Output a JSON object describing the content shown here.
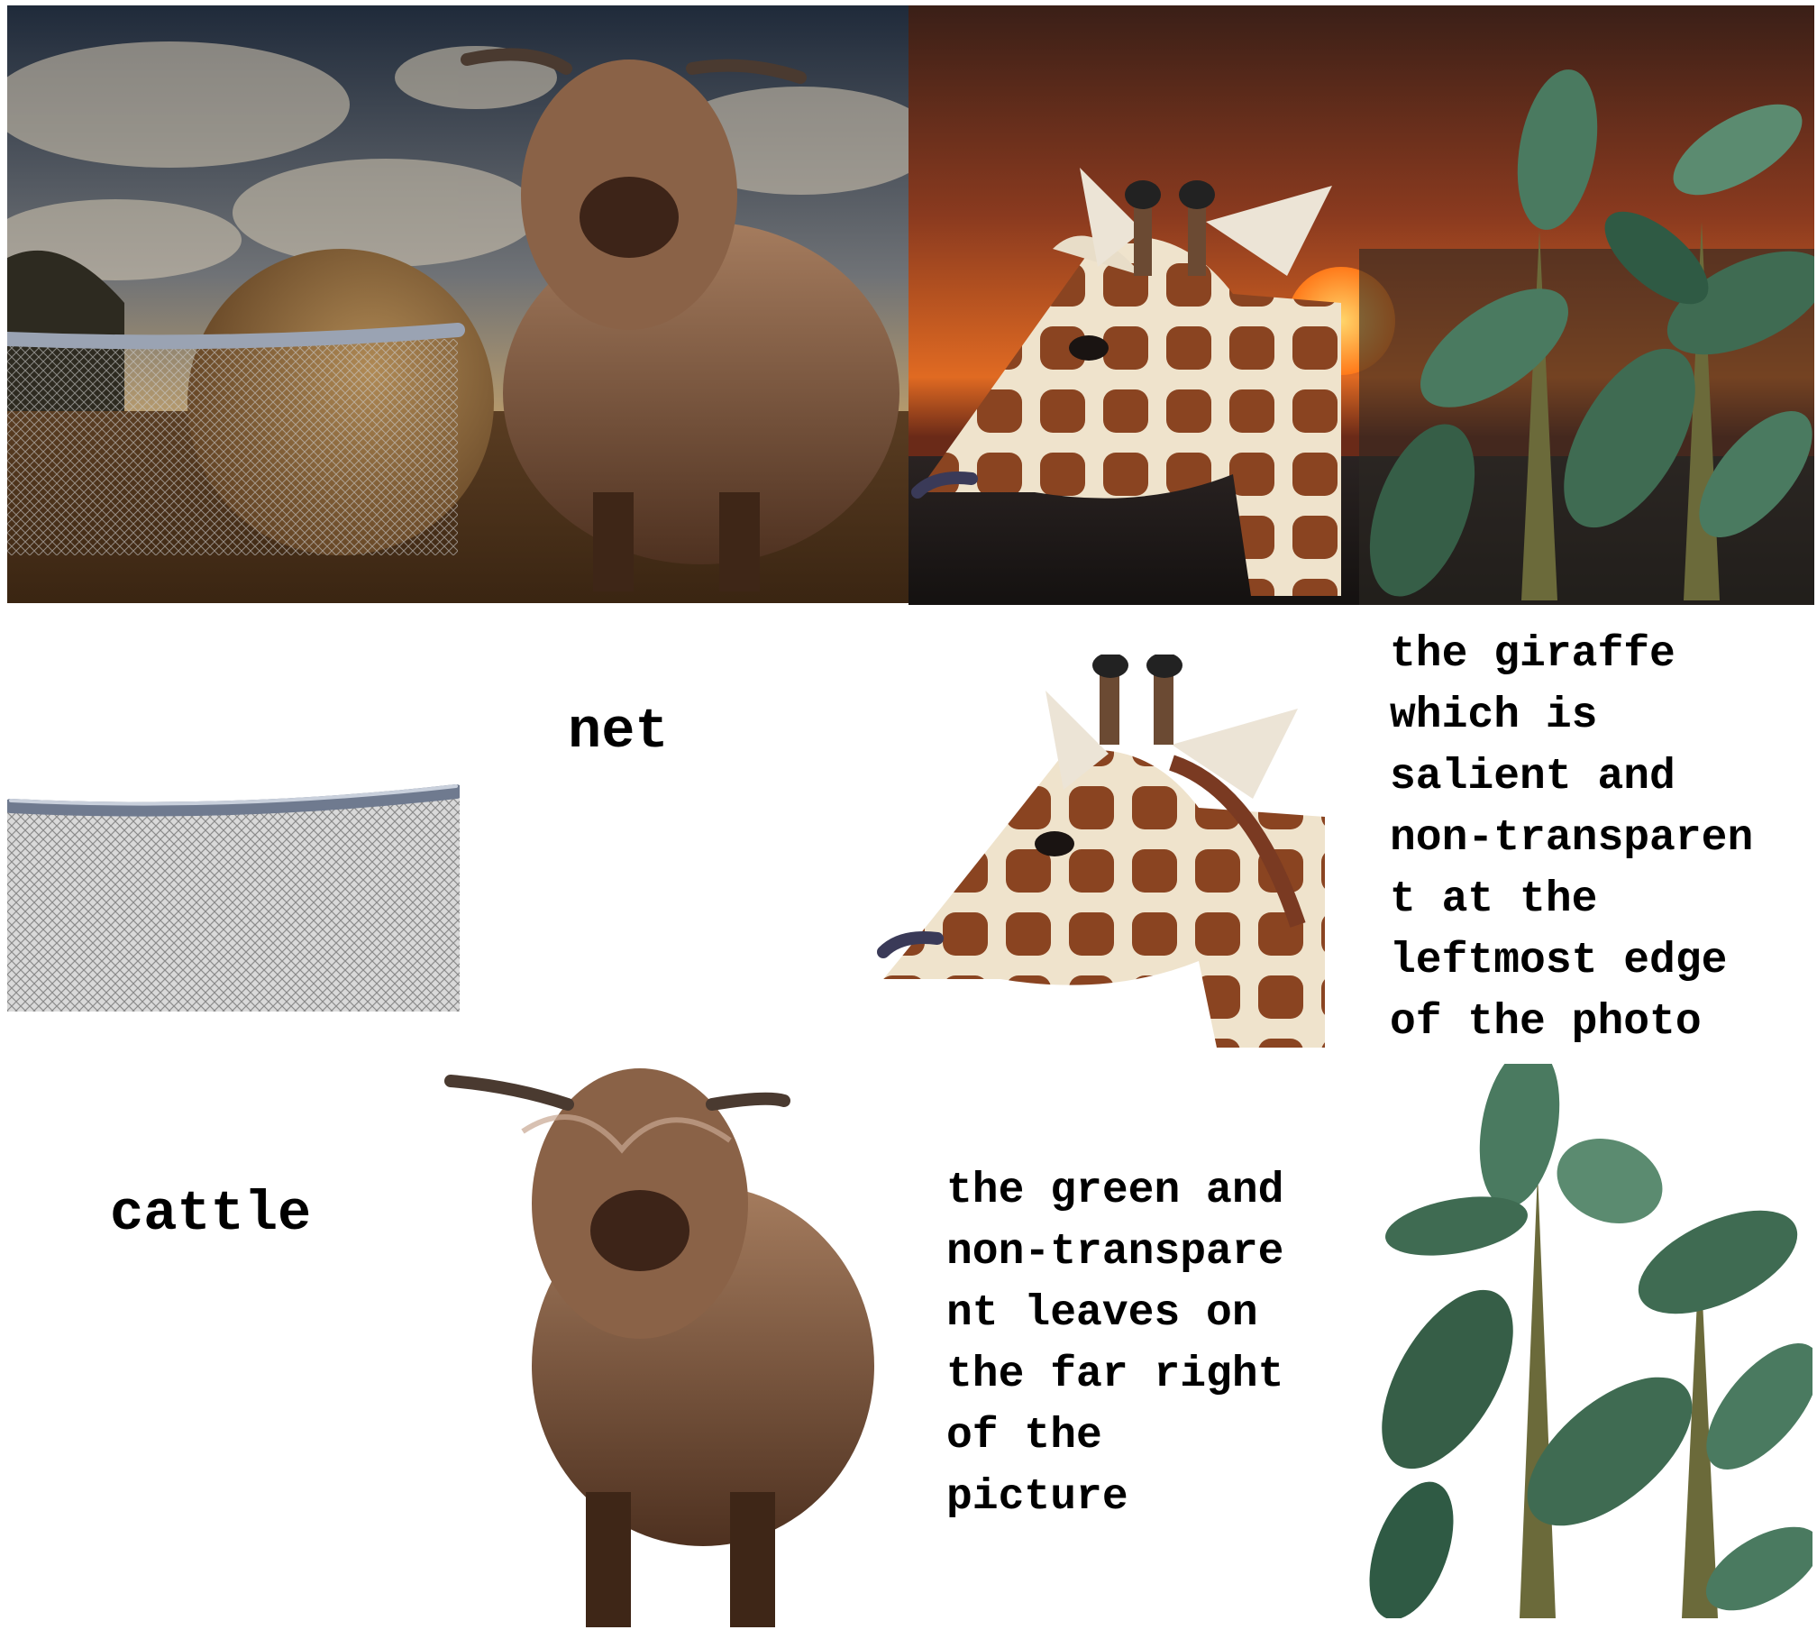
{
  "panels": {
    "cattle_scene": {
      "name": "cattle-scene-photo"
    },
    "giraffe_scene": {
      "name": "giraffe-sunset-photo"
    },
    "net_cutout": {
      "name": "net-cutout"
    },
    "giraffe_cutout": {
      "name": "giraffe-cutout"
    },
    "cattle_cutout": {
      "name": "cattle-cutout"
    },
    "leaves_cutout": {
      "name": "leaves-cutout"
    }
  },
  "labels": {
    "net": "net",
    "cattle": "cattle",
    "giraffe_description": "the giraffe\nwhich is\nsalient and\nnon-transparen\nt at the\nleftmost edge\nof the photo",
    "leaves_description": "the green and\nnon-transpare\nnt leaves on\nthe far right\nof the\npicture"
  },
  "colors": {
    "background": "#ffffff",
    "text": "#000000",
    "cattle_fur": "#7a5238",
    "sunset": "#d9541c",
    "leaf_green": "#3f6b52"
  }
}
